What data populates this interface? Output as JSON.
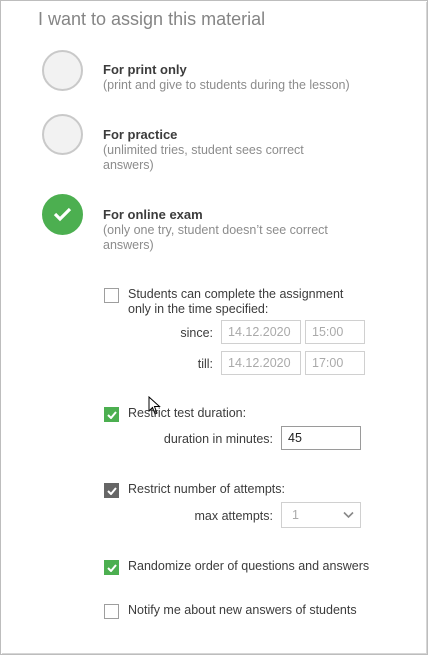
{
  "title": "I want to assign this material",
  "options": [
    {
      "title": "For print only",
      "desc": "(print and give to students during the lesson)",
      "checked": false
    },
    {
      "title": "For practice",
      "desc": "(unlimited tries, student sees correct answers)",
      "checked": false
    },
    {
      "title": "For online exam",
      "desc": "(only one try, student doesn’t see correct answers)",
      "checked": true
    }
  ],
  "time_window": {
    "label": "Students can complete the assignment only in the time specified:",
    "checked": false,
    "since_label": "since:",
    "since_date": "14.12.2020",
    "since_time": "15:00",
    "till_label": "till:",
    "till_date": "14.12.2020",
    "till_time": "17:00"
  },
  "duration": {
    "label": "Restrict test duration:",
    "checked": true,
    "field_label": "duration in minutes:",
    "value": "45"
  },
  "attempts": {
    "label": "Restrict number of attempts:",
    "checked": true,
    "field_label": "max attempts:",
    "value": "1"
  },
  "randomize": {
    "label": "Randomize order of questions and answers",
    "checked": true
  },
  "notify": {
    "label": "Notify me about new answers of students",
    "checked": false
  },
  "colors": {
    "accent": "#4caf50",
    "checkbox_dark": "#666666",
    "text": "#3c3c3c",
    "muted": "#8c8c8c"
  }
}
